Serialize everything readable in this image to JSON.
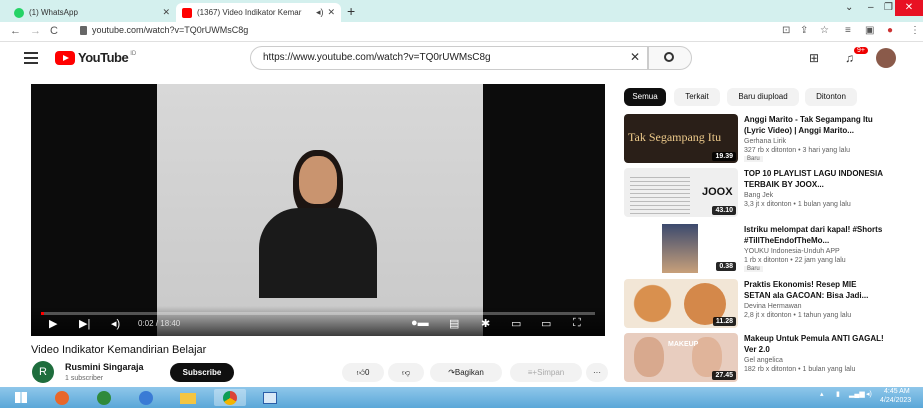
{
  "browser": {
    "tabs": [
      {
        "title": "(1) WhatsApp"
      },
      {
        "title": "(1367) Video Indikator Kemar"
      }
    ],
    "new_tab": "+",
    "url": "youtube.com/watch?v=TQ0rUWMsC8g"
  },
  "youtube": {
    "logo_text": "YouTube",
    "logo_region": "ID",
    "search_value": "https://www.youtube.com/watch?v=TQ0rUWMsC8g",
    "notifications_badge": "9+"
  },
  "player": {
    "time": "0:02 / 18:40",
    "progress": 0.0018
  },
  "video": {
    "title": "Video Indikator Kemandirian Belajar",
    "channel_initial": "R",
    "channel_name": "Rusmini Singaraja",
    "subscribers": "1 subscriber",
    "subscribe_label": "Subscribe",
    "like_count": "0",
    "share_label": "Bagikan",
    "save_label": "Simpan",
    "more_label": "···"
  },
  "chips": [
    "Semua",
    "Terkait",
    "Baru diupload",
    "Ditonton"
  ],
  "recommendations": [
    {
      "title": "Anggi Marito - Tak Segampang Itu (Lyric Video) | Anggi Marito...",
      "channel": "Gerhana Lirik",
      "meta": "327 rb x ditonton • 3 hari yang lalu",
      "badge": "Baru",
      "duration": "19.39",
      "thumb_text": "Tak Segampang Itu"
    },
    {
      "title": "TOP 10 PLAYLIST LAGU INDONESIA TERBAIK BY JOOX...",
      "channel": "Bang Jek",
      "meta": "3,3 jt x ditonton • 1 bulan yang lalu",
      "badge": "",
      "duration": "43.10",
      "thumb_text": "JOOX"
    },
    {
      "title": "Istriku melompat dari kapal! #Shorts #TillTheEndofTheMo...",
      "channel": "YOUKU Indonesia-Unduh APP",
      "meta": "1 rb x ditonton • 22 jam yang lalu",
      "badge": "Baru",
      "duration": "0.38",
      "thumb_text": ""
    },
    {
      "title": "Praktis Ekonomis! Resep MIE SETAN ala GACOAN: Bisa Jadi...",
      "channel": "Devina Hermawan",
      "meta": "2,8 jt x ditonton • 1 tahun yang lalu",
      "badge": "",
      "duration": "11.28",
      "thumb_text": ""
    },
    {
      "title": "Makeup Untuk Pemula ANTI GAGAL! Ver 2.0",
      "channel": "Gel angelica",
      "meta": "182 rb x ditonton • 1 bulan yang lalu",
      "badge": "",
      "duration": "27.45",
      "thumb_text": "MAKEUP"
    }
  ],
  "taskbar": {
    "time": "4:45 AM",
    "date": "4/24/2023"
  },
  "colors": {
    "accent": "#ff0000",
    "tabstrip": "#d4f0ee",
    "taskbar": "#5aa7d8"
  }
}
